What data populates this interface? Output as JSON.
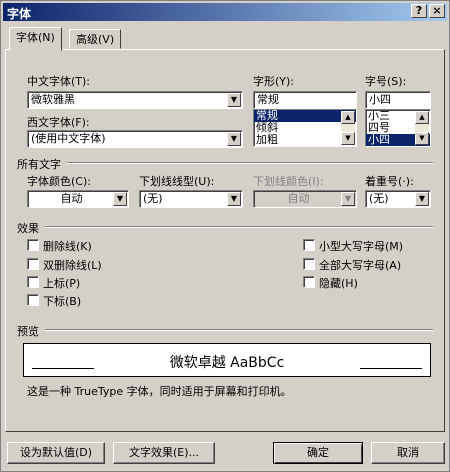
{
  "window": {
    "title": "字体",
    "help_button": "?",
    "close_button": "×"
  },
  "tabs": [
    {
      "label": "字体(N)"
    },
    {
      "label": "高级(V)"
    }
  ],
  "font": {
    "chinese_font_label": "中文字体(T):",
    "chinese_font_value": "微软雅黑",
    "western_font_label": "西文字体(F):",
    "western_font_value": "(使用中文字体)",
    "style_label": "字形(Y):",
    "style_value": "常规",
    "style_options": [
      "常规",
      "倾斜",
      "加粗"
    ],
    "size_label": "字号(S):",
    "size_value": "小四",
    "size_options": [
      "小三",
      "四号",
      "小四"
    ]
  },
  "all_text": {
    "section_label": "所有文字",
    "font_color_label": "字体颜色(C):",
    "font_color_value": "自动",
    "underline_type_label": "下划线线型(U):",
    "underline_type_value": "(无)",
    "underline_color_label": "下划线颜色(I):",
    "underline_color_value": "自动",
    "emphasis_label": "着重号(·):",
    "emphasis_value": "(无)"
  },
  "effects": {
    "section_label": "效果",
    "left": [
      "删除线(K)",
      "双删除线(L)",
      "上标(P)",
      "下标(B)"
    ],
    "right": [
      "小型大写字母(M)",
      "全部大写字母(A)",
      "隐藏(H)"
    ]
  },
  "preview": {
    "section_label": "预览",
    "sample_text": "微软卓越 AaBbCc",
    "description": "这是一种 TrueType 字体，同时适用于屏幕和打印机。"
  },
  "buttons": {
    "set_default": "设为默认值(D)",
    "text_effects": "文字效果(E)...",
    "ok": "确定",
    "cancel": "取消"
  },
  "colors": {
    "titlebar": "#0a246a",
    "selection": "#0a246a",
    "face": "#d4d0c8"
  }
}
